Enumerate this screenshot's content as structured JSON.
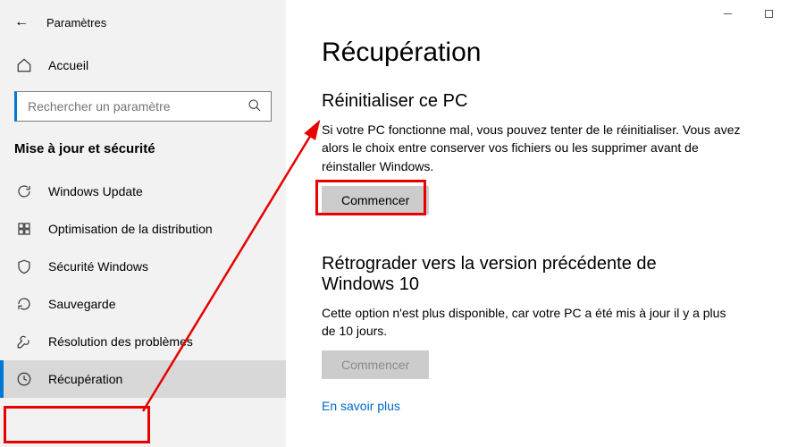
{
  "app": {
    "title": "Paramètres"
  },
  "search": {
    "placeholder": "Rechercher un paramètre"
  },
  "sidebar": {
    "home": "Accueil",
    "group": "Mise à jour et sécurité",
    "items": [
      {
        "label": "Windows Update"
      },
      {
        "label": "Optimisation de la distribution"
      },
      {
        "label": "Sécurité Windows"
      },
      {
        "label": "Sauvegarde"
      },
      {
        "label": "Résolution des problèmes"
      },
      {
        "label": "Récupération"
      }
    ]
  },
  "page": {
    "title": "Récupération",
    "reset": {
      "heading": "Réinitialiser ce PC",
      "desc": "Si votre PC fonctionne mal, vous pouvez tenter de le réinitialiser. Vous avez alors le choix entre conserver vos fichiers ou les supprimer avant de réinstaller Windows.",
      "button": "Commencer"
    },
    "rollback": {
      "heading": "Rétrograder vers la version précédente de Windows 10",
      "desc": "Cette option n'est plus disponible, car votre PC a été mis à jour il y a plus de 10 jours.",
      "button": "Commencer"
    },
    "learn_more": "En savoir plus"
  }
}
